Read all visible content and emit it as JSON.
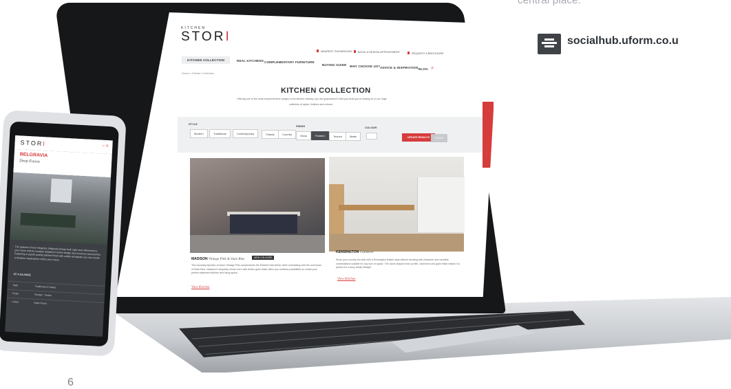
{
  "page": {
    "central_text": "central place.",
    "hub_link": "socialhub.uform.co.u",
    "page_number": "6",
    "hub_icon": "layout-icon"
  },
  "laptop": {
    "logo_small": "KITCHEN",
    "logo_main": "STOR",
    "logo_accent": "I",
    "top_nav": [
      "NEAREST SHOWROOM",
      "BOOK A DESIGN APPOINTMENT",
      "REQUEST A BROCHURE"
    ],
    "main_nav": [
      "KITCHEN COLLECTION",
      "REAL KITCHENS",
      "COMPLEMENTARY FURNITURE",
      "BUYING GUIDE",
      "WHY CHOOSE US?",
      "ADVICE & INSPIRATION",
      "BLOG"
    ],
    "breadcrumb": "Home » Kitchen Collection",
    "title": "KITCHEN COLLECTION",
    "subtitle_line1": "Offering one of the most comprehensive ranges in the kitchen industry, you are guaranteed to find just what you're looking for in our huge",
    "subtitle_line2": "collection of styles, finishes and colours.",
    "filters": {
      "style_label": "STYLE",
      "style_options": [
        "Modern",
        "Traditional",
        "Contemporary",
        "Classic",
        "Country"
      ],
      "finish_label": "FINISH",
      "finish_options": [
        "Gloss",
        "Painted",
        "Texture",
        "Matte"
      ],
      "colour_label": "COLOUR",
      "update_label": "UPDATE RESULTS",
      "clear_label": "CLEAR"
    },
    "cards": [
      {
        "name": "MADISON",
        "desc_italic": "Vintage Pink & Slate Blue",
        "badge": "NEW COLOURS",
        "text": "This stunning injection of warm Vintage Pink complements the Painted Oak timber while contrasting with the cool tones of Slate Blue. Madison's simplicity shown here with timber grain finish offers you endless possibilities to create your perfect statement kitchen and living space.",
        "link": "View Kitchen"
      },
      {
        "name": "KENSINGTON",
        "desc_italic": "Cashmere",
        "text": "Show your country fun side with a Kensington shaker style kitchen bursting with character and versatile combinations suitable for any size of space. The doors shaped inner profile, cashmere and grain finish makes it a perfect for a busy family lifestyle.",
        "link": "View Kitchen"
      }
    ]
  },
  "phone": {
    "logo_main": "STOR",
    "logo_accent": "I",
    "title": "BELGRAVIA",
    "subtitle": "Deep Forest",
    "description": "The epitome of true elegance, Belgravia brings both style and refinement to your home with its ornately detailed in-frame design and luxurious accessories. Featuring a superb quality painted finish with subtle woodgrain you can create a timeless masterpiece within your home.",
    "glance_label": "AT A GLANCE",
    "rows": [
      {
        "label": "Style",
        "value": "Traditional & Classic"
      },
      {
        "label": "Finish",
        "value": "Painted · Timber"
      },
      {
        "label": "Colour",
        "value": "Deep Forest"
      }
    ]
  },
  "colors": {
    "brand_red": "#d63c3c",
    "dark": "#2a2d31"
  }
}
